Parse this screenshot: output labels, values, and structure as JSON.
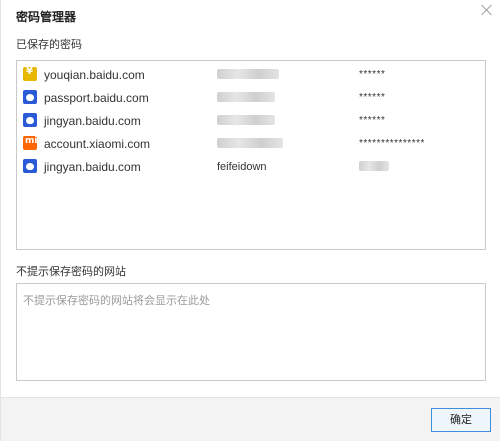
{
  "dialog": {
    "title": "密码管理器",
    "close_icon": "close-icon"
  },
  "saved": {
    "label": "已保存的密码",
    "rows": [
      {
        "icon": "yen-coin-icon",
        "site": "youqian.baidu.com",
        "user": "",
        "password": "******"
      },
      {
        "icon": "baidu-paw-icon",
        "site": "passport.baidu.com",
        "user": "",
        "password": "******"
      },
      {
        "icon": "baidu-paw-icon",
        "site": "jingyan.baidu.com",
        "user": "",
        "password": "******"
      },
      {
        "icon": "xiaomi-logo-icon",
        "site": "account.xiaomi.com",
        "user": "",
        "password": "***************"
      },
      {
        "icon": "baidu-paw-icon",
        "site": "jingyan.baidu.com",
        "user": "feifeidown",
        "password": ""
      }
    ]
  },
  "excluded": {
    "label": "不提示保存密码的网站",
    "placeholder": "不提示保存密码的网站将会显示在此处"
  },
  "footer": {
    "ok_label": "确定"
  }
}
